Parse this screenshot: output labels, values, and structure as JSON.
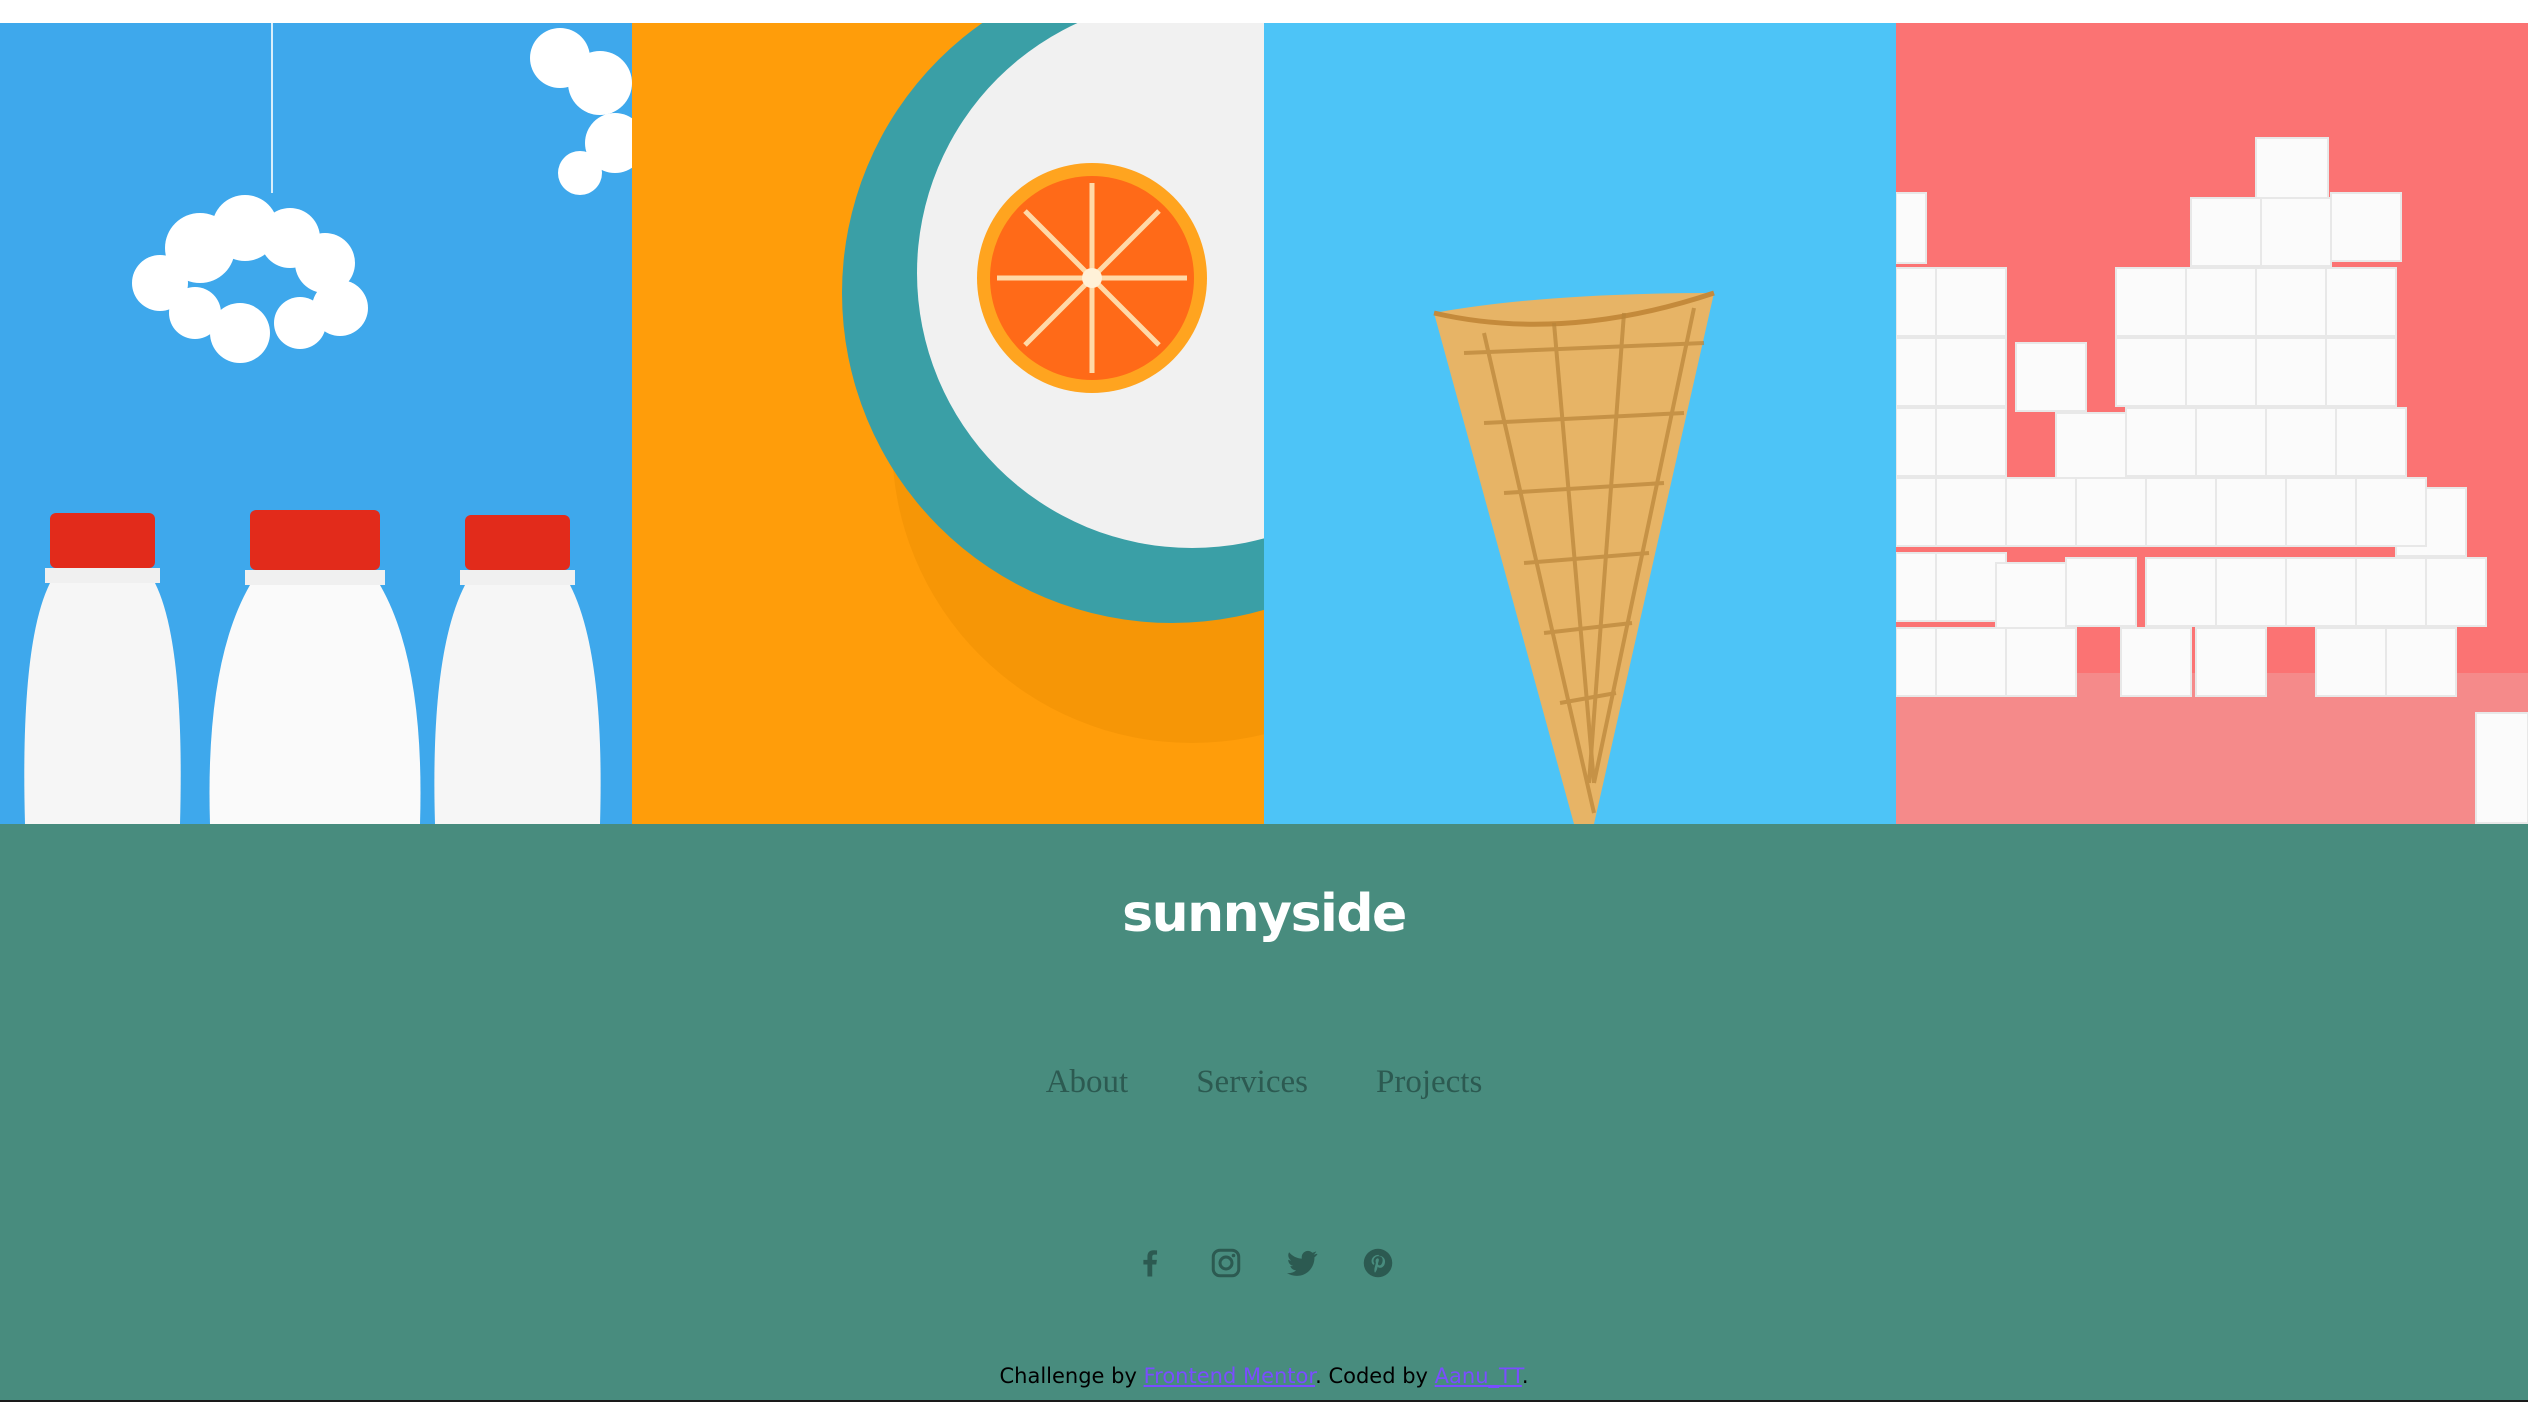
{
  "gallery": {
    "images": [
      {
        "name": "milk-bottles-image",
        "bg": "#3ea8ec"
      },
      {
        "name": "orange-plate-image",
        "bg": "#ff9d0a"
      },
      {
        "name": "ice-cream-cone-image",
        "bg": "#4dc4f7"
      },
      {
        "name": "sugar-cubes-image",
        "bg": "#fb7373"
      }
    ]
  },
  "footer": {
    "bg": "#488c7e",
    "logo": "sunnyside",
    "nav": [
      "About",
      "Services",
      "Projects"
    ],
    "social": [
      "facebook-icon",
      "instagram-icon",
      "twitter-icon",
      "pinterest-icon"
    ]
  },
  "attribution": {
    "prefix": "Challenge by ",
    "link1": "Frontend Mentor",
    "middle": ". Coded by ",
    "link2": "Aanu_TT",
    "suffix": "."
  }
}
